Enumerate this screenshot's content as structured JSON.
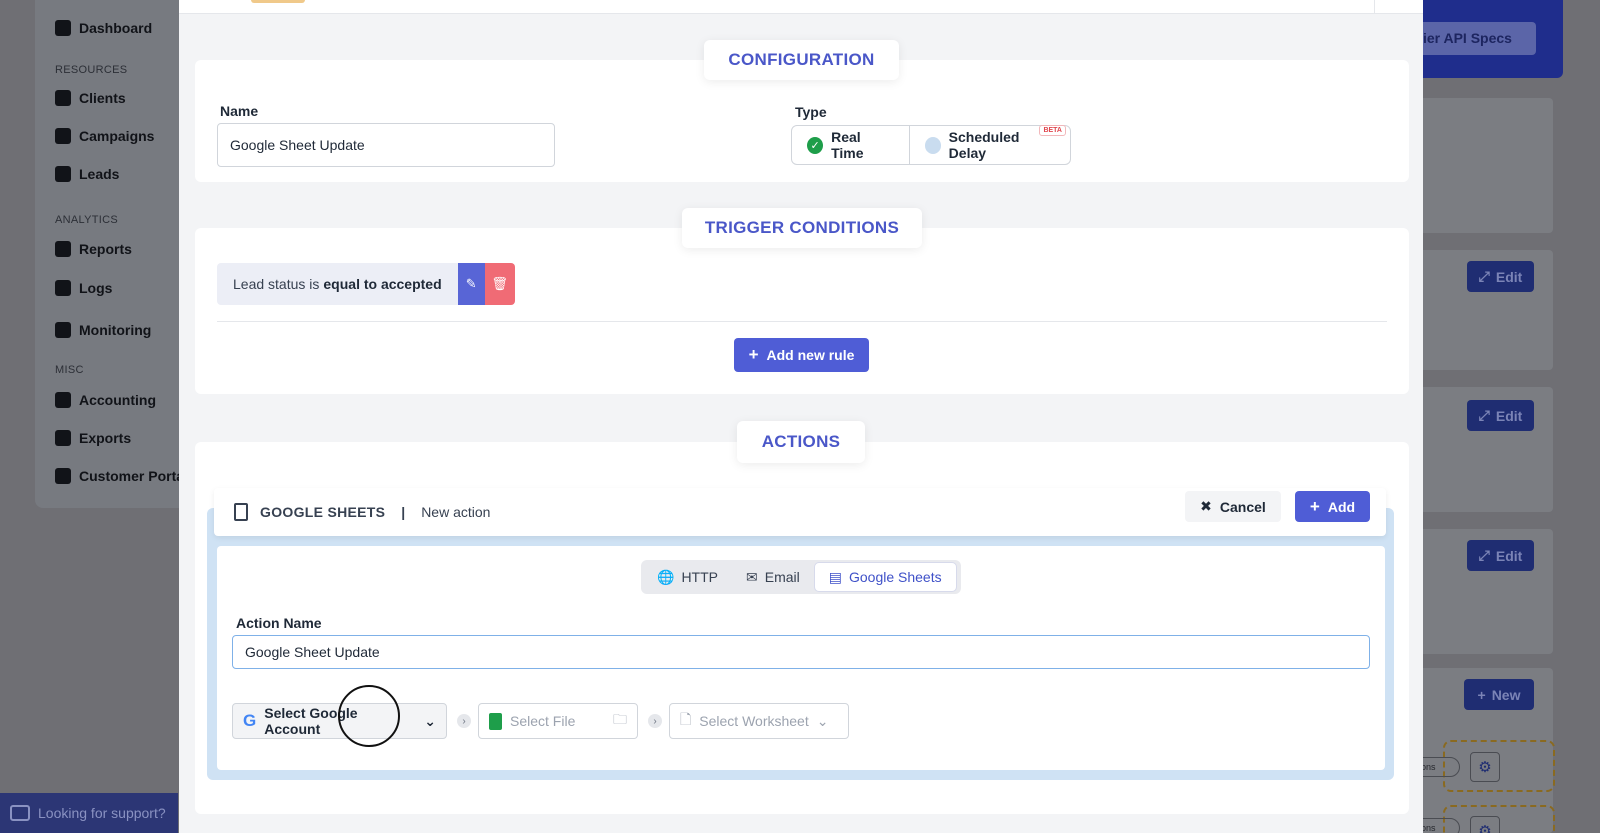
{
  "sidebar": {
    "items": [
      {
        "label": "Dashboard",
        "icon": "monitor-icon"
      },
      {
        "section": "RESOURCES"
      },
      {
        "label": "Clients",
        "icon": "users-icon"
      },
      {
        "label": "Campaigns",
        "icon": "grid-icon"
      },
      {
        "label": "Leads",
        "icon": "leads-icon"
      },
      {
        "section": "ANALYTICS"
      },
      {
        "label": "Reports",
        "icon": "pie-chart-icon"
      },
      {
        "label": "Logs",
        "icon": "file-icon"
      },
      {
        "label": "Monitoring",
        "icon": "truck-icon"
      },
      {
        "section": "MISC"
      },
      {
        "label": "Accounting",
        "icon": "coins-icon"
      },
      {
        "label": "Exports",
        "icon": "export-icon"
      },
      {
        "label": "Customer Porta",
        "icon": "group-icon"
      }
    ],
    "support_label": "Looking for support?"
  },
  "background": {
    "spec_button": "pplier API Specs",
    "edit_label": "Edit",
    "new_label": "New",
    "pill_label": "actions"
  },
  "configuration": {
    "title": "CONFIGURATION",
    "name_label": "Name",
    "name_value": "Google Sheet Update",
    "type_label": "Type",
    "type_options": {
      "realtime": "Real Time",
      "scheduled": "Scheduled Delay",
      "beta": "BETA"
    }
  },
  "trigger": {
    "title": "TRIGGER CONDITIONS",
    "rule_prefix": "Lead status is",
    "rule_bold": "equal to accepted",
    "add_rule_label": "Add new rule"
  },
  "actions": {
    "title": "ACTIONS",
    "provider": "GOOGLE SHEETS",
    "separator": "|",
    "subtitle": "New action",
    "cancel_label": "Cancel",
    "add_label": "Add",
    "tabs": {
      "http": "HTTP",
      "email": "Email",
      "sheets": "Google Sheets"
    },
    "active_tab": "Google Sheets",
    "action_name_label": "Action Name",
    "action_name_value": "Google Sheet Update",
    "select_account": "Select Google Account",
    "select_file": "Select File",
    "select_worksheet": "Select Worksheet"
  },
  "colors": {
    "accent": "#4f5dd6",
    "success": "#1e9e4a",
    "danger": "#f06b75"
  }
}
